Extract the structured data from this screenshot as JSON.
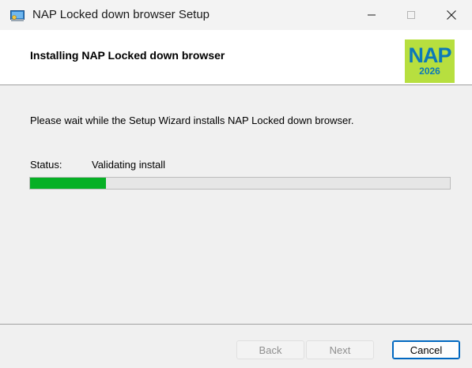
{
  "window": {
    "title": "NAP Locked down browser Setup",
    "icon": "installer-icon",
    "controls": {
      "minimize": "minimize-icon",
      "maximize": "maximize-icon",
      "close": "close-icon"
    }
  },
  "banner": {
    "heading": "Installing NAP Locked down browser",
    "logo": {
      "text": "NAP",
      "year": "2026",
      "background": "#b7df3f",
      "color": "#0c78b8"
    }
  },
  "body": {
    "message": "Please wait while the Setup Wizard installs NAP Locked down browser.",
    "status_label": "Status:",
    "status_value": "Validating install",
    "progress": {
      "value": 0.18,
      "color": "#06b025"
    }
  },
  "buttons": {
    "back": "Back",
    "next": "Next",
    "cancel": "Cancel"
  }
}
